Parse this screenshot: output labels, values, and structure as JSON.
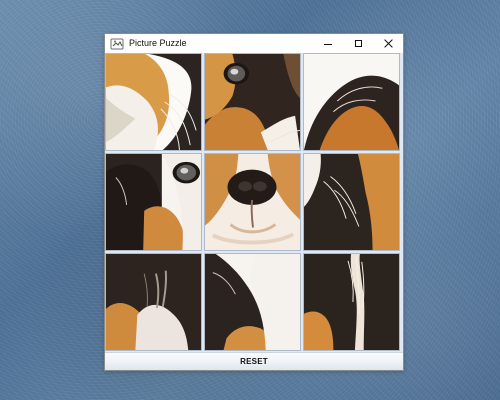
{
  "window": {
    "title": "Picture Puzzle"
  },
  "controls": {
    "minimize_icon": "minimize-icon",
    "maximize_icon": "maximize-icon",
    "close_icon": "close-icon"
  },
  "puzzle": {
    "tiles": [
      {
        "name": "puzzle-tile-1"
      },
      {
        "name": "puzzle-tile-2"
      },
      {
        "name": "puzzle-tile-3"
      },
      {
        "name": "puzzle-tile-4"
      },
      {
        "name": "puzzle-tile-5"
      },
      {
        "name": "puzzle-tile-6"
      },
      {
        "name": "puzzle-tile-7"
      },
      {
        "name": "puzzle-tile-8"
      },
      {
        "name": "puzzle-tile-9"
      }
    ]
  },
  "reset_button": {
    "label": "RESET"
  },
  "colors": {
    "window_border": "#8b8b8b",
    "tile_border": "#aeb9ca",
    "button_top": "#f9fbfd",
    "button_bottom": "#dde5ef",
    "background_blue": "#5b7fa6"
  }
}
